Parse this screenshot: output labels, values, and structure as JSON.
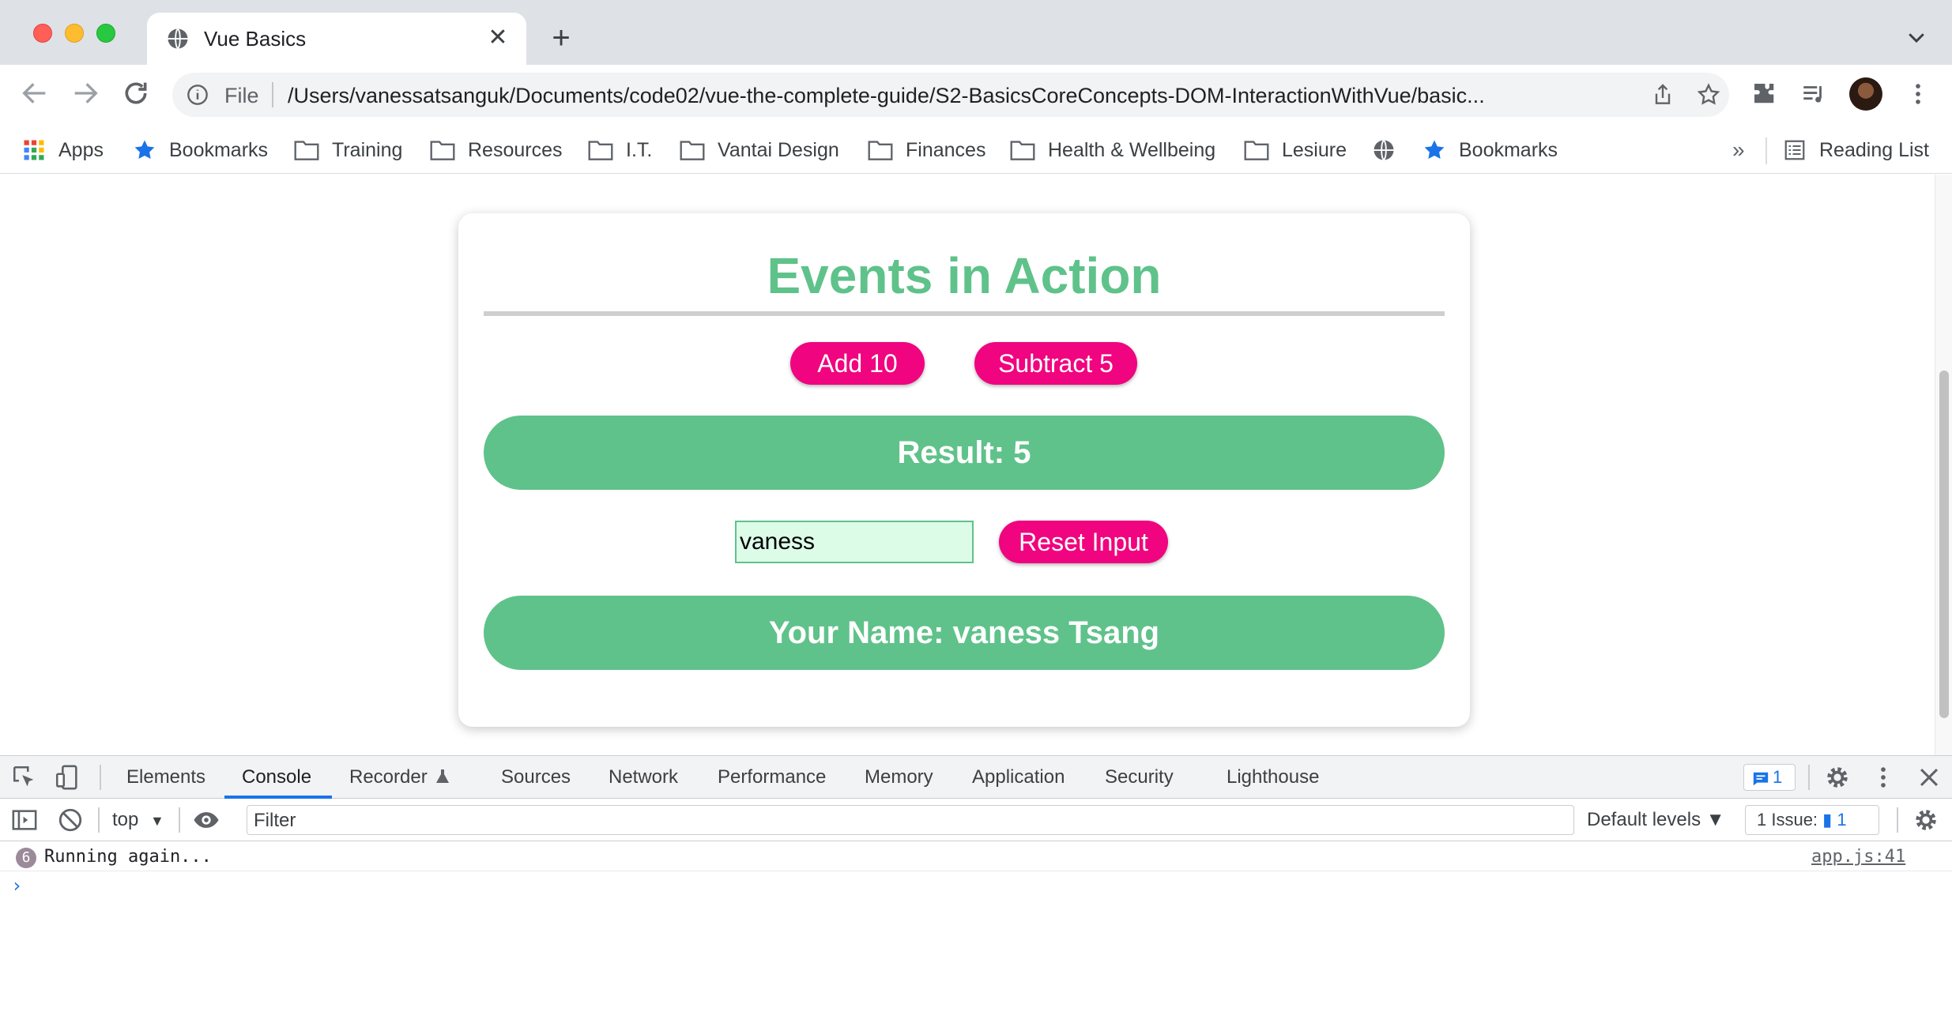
{
  "browser": {
    "tab_title": "Vue Basics",
    "new_tab_symbol": "+",
    "close_symbol": "✕",
    "omnibox": {
      "scheme_label": "File",
      "url": "/Users/vanessatsanguk/Documents/code02/vue-the-complete-guide/S2-BasicsCoreConcepts-DOM-InteractionWithVue/basic..."
    },
    "bookmarks": [
      {
        "label": "Apps",
        "icon": "apps-grid-icon"
      },
      {
        "label": "Bookmarks",
        "icon": "star-icon"
      },
      {
        "label": "Training",
        "icon": "folder-icon"
      },
      {
        "label": "Resources",
        "icon": "folder-icon"
      },
      {
        "label": "I.T.",
        "icon": "folder-icon"
      },
      {
        "label": "Vantai Design",
        "icon": "folder-icon"
      },
      {
        "label": "Finances",
        "icon": "folder-icon"
      },
      {
        "label": "Health & Wellbeing",
        "icon": "folder-icon"
      },
      {
        "label": "Lesiure",
        "icon": "folder-icon"
      },
      {
        "label": "",
        "icon": "globe-icon"
      },
      {
        "label": "Bookmarks",
        "icon": "star-icon"
      }
    ],
    "bookmarks_overflow": "»",
    "reading_list": "Reading List"
  },
  "app": {
    "title": "Events in Action",
    "add_button": "Add 10",
    "subtract_button": "Subtract 5",
    "result_text": "Result: 5",
    "name_input_value": "vaness",
    "reset_button": "Reset Input",
    "name_text": "Your Name: vaness Tsang",
    "colors": {
      "accent_green": "#5fc28a",
      "button_pink": "#f0047f",
      "input_bg": "#dcfce8"
    }
  },
  "devtools": {
    "tabs": [
      "Elements",
      "Console",
      "Recorder",
      "Sources",
      "Network",
      "Performance",
      "Memory",
      "Application",
      "Security",
      "Lighthouse"
    ],
    "active_tab": "Console",
    "messages_count": "1",
    "context": "top",
    "context_arrow": "▼",
    "filter_placeholder": "Filter",
    "levels": "Default levels ▼",
    "issues_label": "1 Issue:",
    "issues_count": "1",
    "console_entries": [
      {
        "repeat": "6",
        "message": "Running again...",
        "source": "app.js:41"
      }
    ],
    "prompt_symbol": "›"
  }
}
